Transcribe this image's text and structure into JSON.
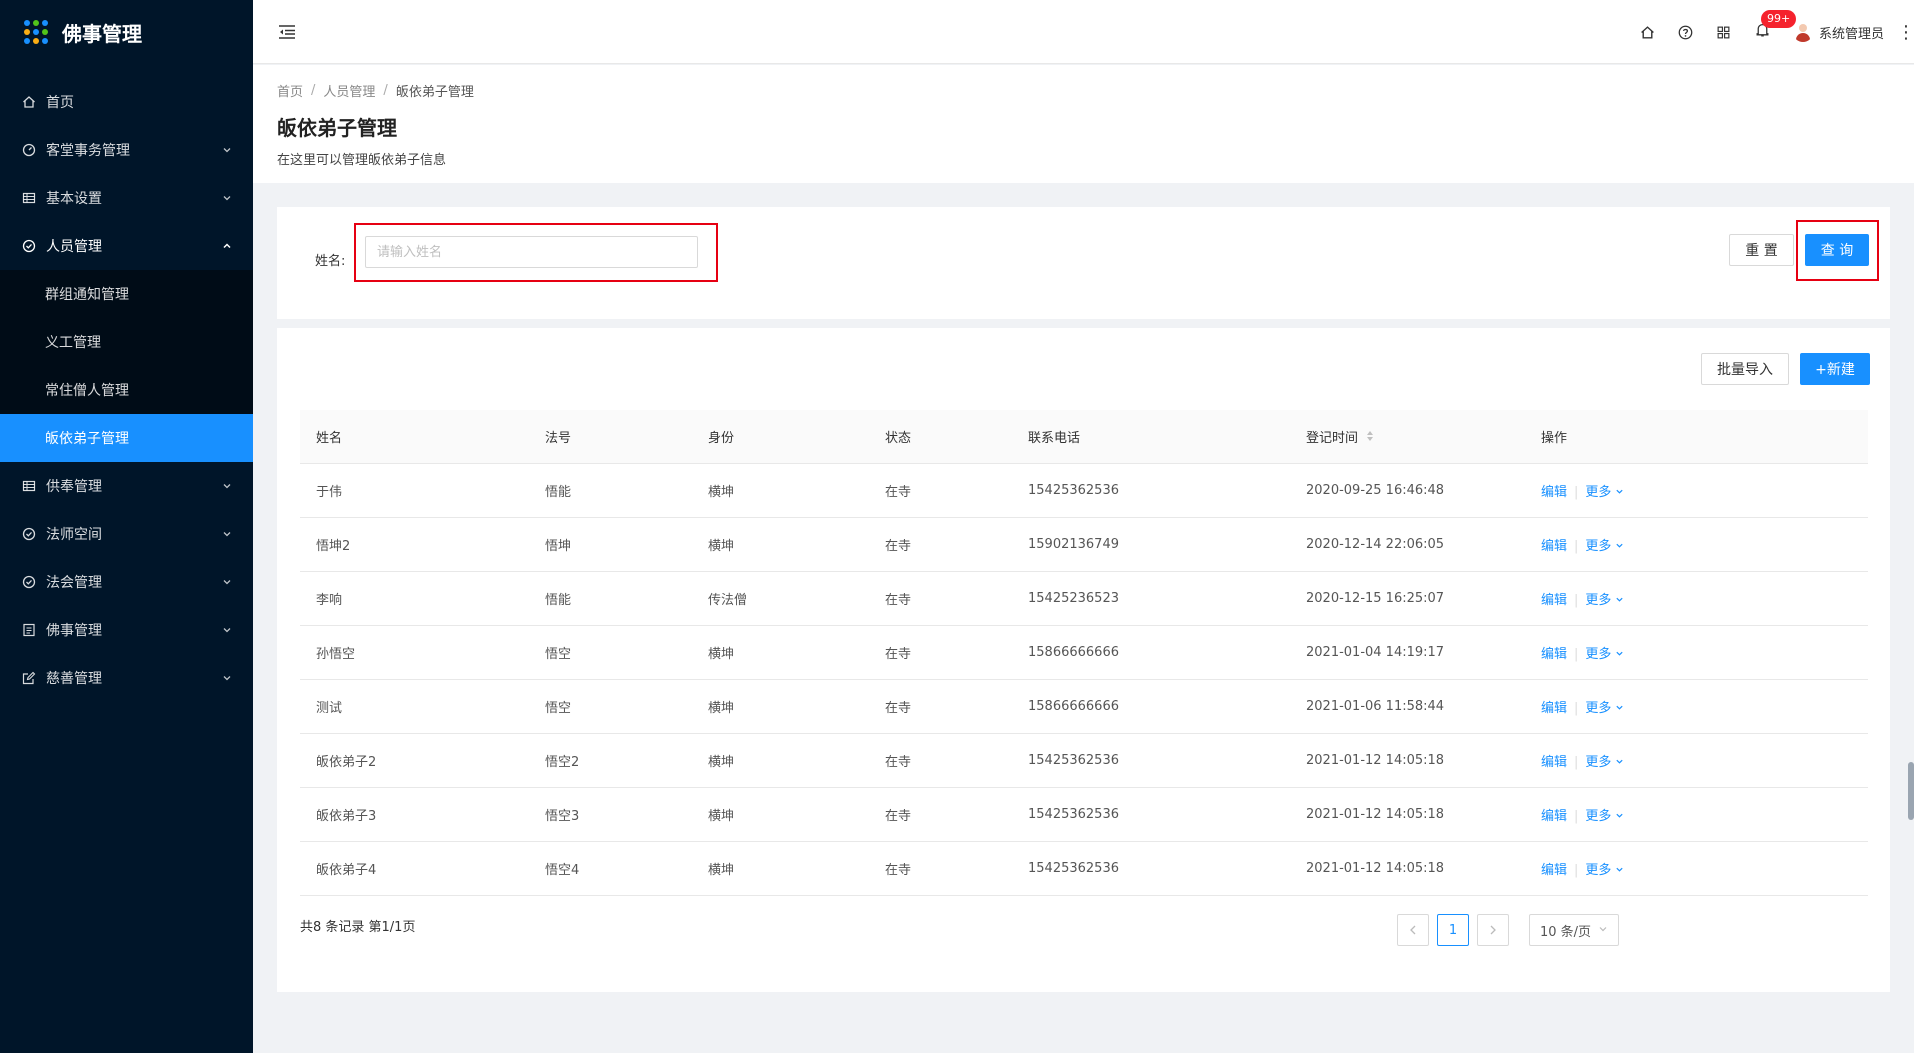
{
  "app": {
    "title": "佛事管理"
  },
  "sidebar": {
    "items": [
      {
        "label": "首页",
        "icon": "home-icon"
      },
      {
        "label": "客堂事务管理",
        "icon": "dashboard-icon"
      },
      {
        "label": "基本设置",
        "icon": "table-icon"
      },
      {
        "label": "人员管理",
        "icon": "check-circle-icon"
      },
      {
        "label": "供奉管理",
        "icon": "table-icon"
      },
      {
        "label": "法师空间",
        "icon": "check-circle-icon"
      },
      {
        "label": "法会管理",
        "icon": "check-circle-icon"
      },
      {
        "label": "佛事管理",
        "icon": "profile-icon"
      },
      {
        "label": "慈善管理",
        "icon": "form-icon"
      }
    ],
    "sub_items": [
      {
        "label": "群组通知管理"
      },
      {
        "label": "义工管理"
      },
      {
        "label": "常住僧人管理"
      },
      {
        "label": "皈依弟子管理"
      }
    ]
  },
  "header": {
    "notification_count": "99+",
    "user_name": "系统管理员"
  },
  "breadcrumb": [
    "首页",
    "人员管理",
    "皈依弟子管理"
  ],
  "page": {
    "title": "皈依弟子管理",
    "description": "在这里可以管理皈依弟子信息"
  },
  "search": {
    "name_label": "姓名:",
    "name_placeholder": "请输入姓名",
    "reset_label": "重 置",
    "query_label": "查 询"
  },
  "toolbar": {
    "import_label": "批量导入",
    "new_label": "+新建"
  },
  "table": {
    "columns": [
      "姓名",
      "法号",
      "身份",
      "状态",
      "联系电话",
      "登记时间",
      "操作"
    ],
    "rows": [
      {
        "name": "于伟",
        "dharma": "悟能",
        "identity": "横坤",
        "status": "在寺",
        "phone": "15425362536",
        "time": "2020-09-25 16:46:48"
      },
      {
        "name": "悟坤2",
        "dharma": "悟坤",
        "identity": "横坤",
        "status": "在寺",
        "phone": "15902136749",
        "time": "2020-12-14 22:06:05"
      },
      {
        "name": "李响",
        "dharma": "悟能",
        "identity": "传法僧",
        "status": "在寺",
        "phone": "15425236523",
        "time": "2020-12-15 16:25:07"
      },
      {
        "name": "孙悟空",
        "dharma": "悟空",
        "identity": "横坤",
        "status": "在寺",
        "phone": "15866666666",
        "time": "2021-01-04 14:19:17"
      },
      {
        "name": "测试",
        "dharma": "悟空",
        "identity": "横坤",
        "status": "在寺",
        "phone": "15866666666",
        "time": "2021-01-06 11:58:44"
      },
      {
        "name": "皈依弟子2",
        "dharma": "悟空2",
        "identity": "横坤",
        "status": "在寺",
        "phone": "15425362536",
        "time": "2021-01-12 14:05:18"
      },
      {
        "name": "皈依弟子3",
        "dharma": "悟空3",
        "identity": "横坤",
        "status": "在寺",
        "phone": "15425362536",
        "time": "2021-01-12 14:05:18"
      },
      {
        "name": "皈依弟子4",
        "dharma": "悟空4",
        "identity": "横坤",
        "status": "在寺",
        "phone": "15425362536",
        "time": "2021-01-12 14:05:18"
      }
    ],
    "action_edit": "编辑",
    "action_more": "更多"
  },
  "pagination": {
    "summary": "共8 条记录 第1/1页",
    "current_page": "1",
    "page_size": "10 条/页"
  },
  "colors": {
    "sidebar_bg": "#001529",
    "primary": "#1890ff",
    "highlight": "#e60012"
  }
}
